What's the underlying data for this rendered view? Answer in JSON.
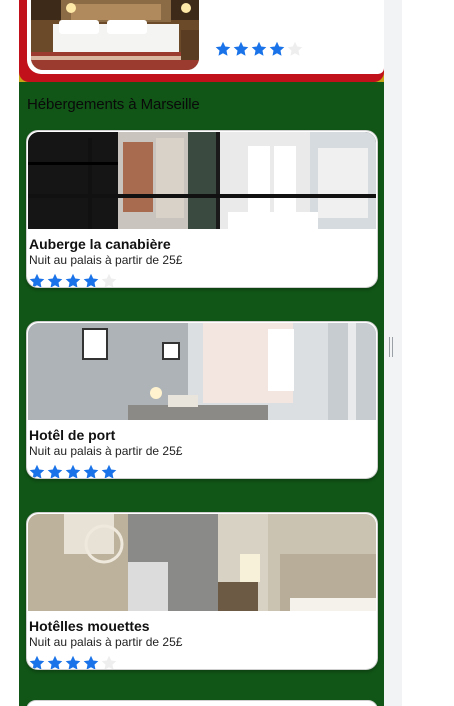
{
  "top_card": {
    "rating": 4,
    "max_rating": 5
  },
  "section": {
    "title": "Hébergements à Marseille"
  },
  "listings": [
    {
      "name": "Auberge la canabière",
      "description": "Nuit au palais à partir de 25£",
      "rating": 4,
      "max_rating": 5
    },
    {
      "name": "Hotêl de port",
      "description": "Nuit au palais à partir de 25£",
      "rating": 5,
      "max_rating": 5
    },
    {
      "name": "Hotêlles mouettes",
      "description": "Nuit au palais à partir de 25£",
      "rating": 4,
      "max_rating": 5
    }
  ],
  "colors": {
    "section_bg": "#115617",
    "frame_red": "#c1121b",
    "frame_yellow": "#c8a417",
    "star_filled": "#1a73e8",
    "star_empty": "#eeeeee"
  },
  "icons": {
    "star": "star-icon"
  }
}
